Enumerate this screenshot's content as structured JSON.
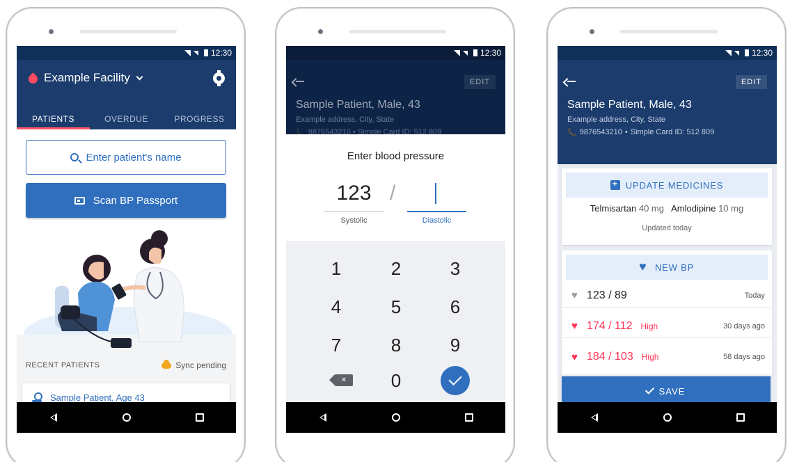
{
  "status_time": "12:30",
  "nav": {
    "back": "back",
    "home": "home",
    "recents": "recents"
  },
  "phone1": {
    "facility_name": "Example Facility",
    "tabs": [
      {
        "label": "PATIENTS",
        "active": true
      },
      {
        "label": "OVERDUE",
        "active": false
      },
      {
        "label": "PROGRESS",
        "active": false
      }
    ],
    "search_placeholder": "Enter patient's name",
    "scan_button": "Scan BP Passport",
    "recent_label": "RECENT PATIENTS",
    "sync_label": "Sync pending",
    "recent_patient": "Sample Patient, Age 43"
  },
  "phone2": {
    "edit": "EDIT",
    "patient_name": "Sample Patient, Male, 43",
    "address": "Example address, City, State",
    "phone_partial": "9876543210 • Simple Card ID: 512 809",
    "sheet_title": "Enter blood pressure",
    "systolic_value": "123",
    "slash": "/",
    "systolic_label": "Systolic",
    "diastolic_label": "Diastolic",
    "keys": [
      "1",
      "2",
      "3",
      "4",
      "5",
      "6",
      "7",
      "8",
      "9",
      "0"
    ]
  },
  "phone3": {
    "edit": "EDIT",
    "patient_name": "Sample Patient, Male, 43",
    "address": "Example address, City, State",
    "phone": "9876543210",
    "card_id": "Simple Card ID: 512 809",
    "update_medicines": "UPDATE MEDICINES",
    "meds": [
      {
        "name": "Telmisartan",
        "dose": "40 mg"
      },
      {
        "name": "Amlodipine",
        "dose": "10 mg"
      }
    ],
    "meds_updated": "Updated today",
    "new_bp": "NEW BP",
    "bp_readings": [
      {
        "value": "123 / 89",
        "high": "",
        "when": "Today",
        "color": "#9aa0a6",
        "text_color": "#222222"
      },
      {
        "value": "174 / 112",
        "high": "High",
        "when": "30 days ago",
        "color": "#ff3355",
        "text_color": "#ff3355"
      },
      {
        "value": "184 / 103",
        "high": "High",
        "when": "58 days ago",
        "color": "#ff3355",
        "text_color": "#ff3355"
      }
    ],
    "save": "SAVE"
  },
  "colors": {
    "primary": "#2f6fbe",
    "header": "#1b3c6d",
    "alert": "#ff3355"
  }
}
